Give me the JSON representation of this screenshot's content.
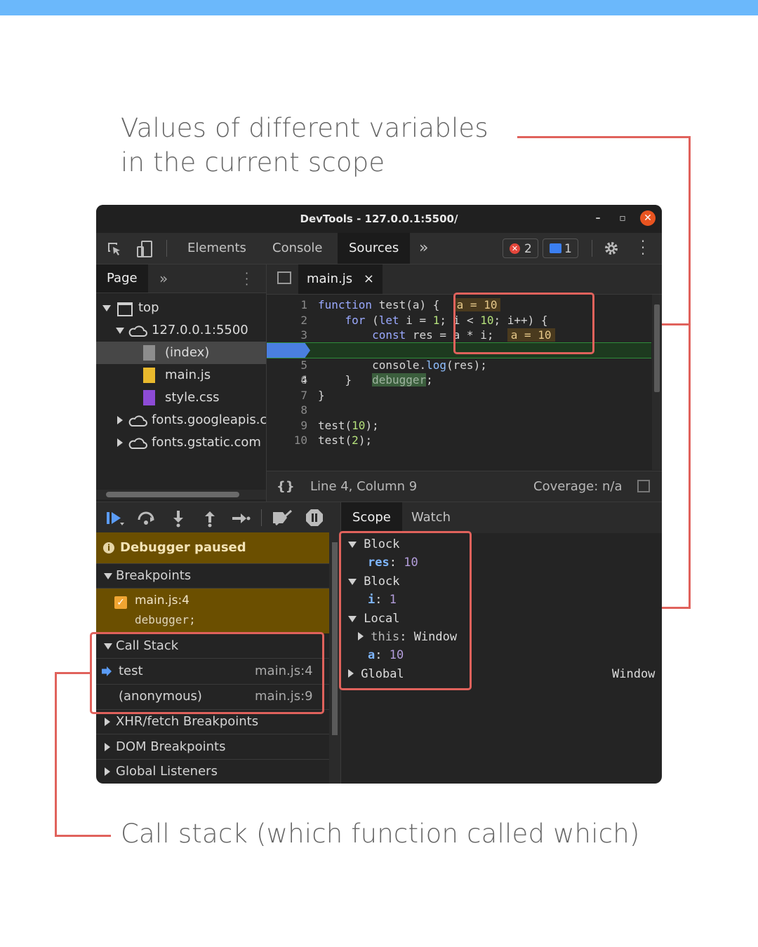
{
  "annotations": {
    "top_line1": "Values of different variables",
    "top_line2": "in the current scope",
    "bottom": "Call stack (which function called which)"
  },
  "window": {
    "title": "DevTools - 127.0.0.1:5500/",
    "tabs": [
      "Elements",
      "Console",
      "Sources"
    ],
    "active_tab": "Sources",
    "errors_count": "2",
    "messages_count": "1"
  },
  "navigator": {
    "tab": "Page",
    "tree": [
      "top",
      "127.0.0.1:5500",
      "(index)",
      "main.js",
      "style.css",
      "fonts.googleapis.c",
      "fonts.gstatic.com"
    ]
  },
  "editor": {
    "file_tab": "main.js",
    "close_glyph": "×",
    "line_numbers": [
      "1",
      "2",
      "3",
      "4",
      "5",
      "6",
      "7",
      "8",
      "9",
      "10"
    ],
    "inline_a1": "a = 10",
    "inline_a2": "a = 10",
    "status_position": "Line 4, Column 9",
    "status_coverage": "Coverage: n/a",
    "format_glyph": "{}"
  },
  "debugger": {
    "paused": "Debugger paused",
    "breakpoints_header": "Breakpoints",
    "breakpoint_file": "main.js:4",
    "breakpoint_code": "debugger;",
    "callstack_header": "Call Stack",
    "frames": [
      {
        "name": "test",
        "loc": "main.js:4"
      },
      {
        "name": "(anonymous)",
        "loc": "main.js:9"
      }
    ],
    "xhr": "XHR/fetch Breakpoints",
    "dom": "DOM Breakpoints",
    "global": "Global Listeners"
  },
  "scope": {
    "tabs": [
      "Scope",
      "Watch"
    ],
    "block1": "Block",
    "res_key": "res",
    "res_val": "10",
    "block2": "Block",
    "i_key": "i",
    "i_val": "1",
    "local": "Local",
    "this_key": "this",
    "this_val": "Window",
    "a_key": "a",
    "a_val": "10",
    "global": "Global",
    "global_val": "Window"
  },
  "colors": {
    "accent_red": "#e0625c",
    "paused_bg": "#6b4f00",
    "topbar": "#6bb8fb"
  }
}
